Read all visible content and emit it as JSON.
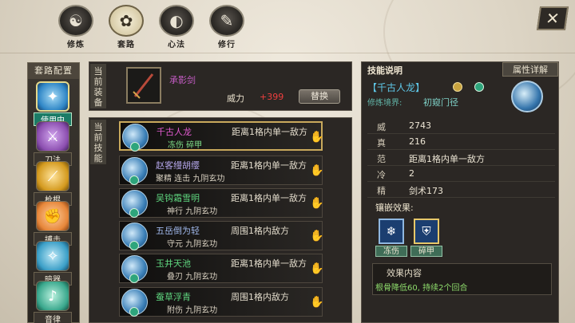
{
  "tabs": [
    {
      "label": "修炼",
      "icon": "swirl-icon"
    },
    {
      "label": "套路",
      "icon": "lotus-icon"
    },
    {
      "label": "心法",
      "icon": "yin-yang-icon"
    },
    {
      "label": "修行",
      "icon": "scroll-icon"
    }
  ],
  "sidebar": {
    "title": "套路配置",
    "items": [
      {
        "label": "使用中",
        "selected": true,
        "color": "#2f86c6"
      },
      {
        "label": "刀法",
        "selected": false,
        "color": "#8c4fb0"
      },
      {
        "label": "枪棍",
        "selected": false,
        "color": "#d49a1f"
      },
      {
        "label": "搏击",
        "selected": false,
        "color": "#e7873a"
      },
      {
        "label": "暗器",
        "selected": false,
        "color": "#3b9fc7"
      },
      {
        "label": "音律",
        "selected": false,
        "color": "#3aa88d"
      }
    ]
  },
  "equipment": {
    "section_label": "当前装备",
    "weapon_name": "承影剑",
    "power_label": "威力",
    "power_value": "+399",
    "swap_label": "替换"
  },
  "skills": {
    "section_label": "当前技能",
    "items": [
      {
        "name": "千古人龙",
        "name_color": "#e25ad0",
        "effects": "冻伤  碎甲",
        "effects_color": "#7fe08a",
        "range": "距离1格内单一敌方",
        "note": "",
        "active": true
      },
      {
        "name": "赵客缦胡缨",
        "name_color": "#b4a6ea",
        "effects": "聚精  连击  九阴玄功",
        "effects_color": "#d8d0c0",
        "range": "距离1格内单一敌方",
        "note": "",
        "active": false
      },
      {
        "name": "吴钩霜雪明",
        "name_color": "#5fd67f",
        "effects": "神行  九阴玄功",
        "effects_color": "#d8d0c0",
        "range": "距离1格内单一敌方",
        "note": "",
        "active": false
      },
      {
        "name": "五岳倒为轻",
        "name_color": "#9fb7ea",
        "effects": "守元  九阴玄功",
        "effects_color": "#d8d0c0",
        "range": "周围1格内敌方",
        "note": "",
        "active": false
      },
      {
        "name": "玉井天池",
        "name_color": "#5fd67f",
        "effects": "叠刃  九阴玄功",
        "effects_color": "#d8d0c0",
        "range": "距离1格内单一敌方",
        "note": "",
        "active": false
      },
      {
        "name": "蚕草浮青",
        "name_color": "#5fd67f",
        "effects": "附伤  九阴玄功",
        "effects_color": "#d8d0c0",
        "range": "周围1格内敌方",
        "note": "",
        "active": false
      }
    ]
  },
  "detail": {
    "title": "技能说明",
    "tab_label": "属性详解",
    "skill_name": "【千古人龙】",
    "realm_label": "修炼境界:",
    "realm_value": "初窥门径",
    "stats": [
      {
        "key": "威",
        "value": "2743"
      },
      {
        "key": "真",
        "value": "216"
      },
      {
        "key": "范",
        "value": "距离1格内单一敌方"
      },
      {
        "key": "冷",
        "value": "2"
      },
      {
        "key": "精",
        "value": "剑术173"
      }
    ],
    "inlay_label": "镶嵌效果:",
    "gems": [
      {
        "label": "冻伤",
        "icon": "snowflake-icon"
      },
      {
        "label": "碎甲",
        "icon": "shield-break-icon"
      }
    ],
    "effect_title": "效果内容",
    "effect_text": "根骨降低60, 持续2个回合"
  }
}
